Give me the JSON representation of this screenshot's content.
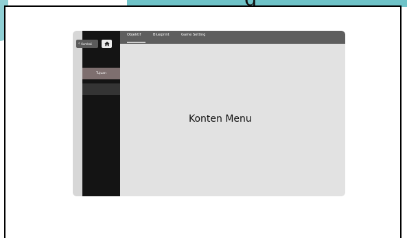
{
  "window": {
    "title_fragment": "g"
  },
  "nav": {
    "back_label": "Kembali"
  },
  "tabs": [
    {
      "label": "Objektif",
      "active": true
    },
    {
      "label": "Blueprint",
      "active": false
    },
    {
      "label": "Game Setting",
      "active": false
    }
  ],
  "sidebar": {
    "items": [
      {
        "label": "Tujuan",
        "active": true
      },
      {
        "label": "",
        "active": false
      }
    ]
  },
  "content": {
    "text": "Konten Menu"
  },
  "icons": {
    "back": "chevron-left-icon",
    "home": "home-icon"
  },
  "colors": {
    "sidebar": "#141414",
    "tab_bar": "#5e5e5e",
    "content_bg": "#e2e2e2",
    "active_item": "#7e6f6f",
    "teal_accent": "#6fc3c8"
  }
}
